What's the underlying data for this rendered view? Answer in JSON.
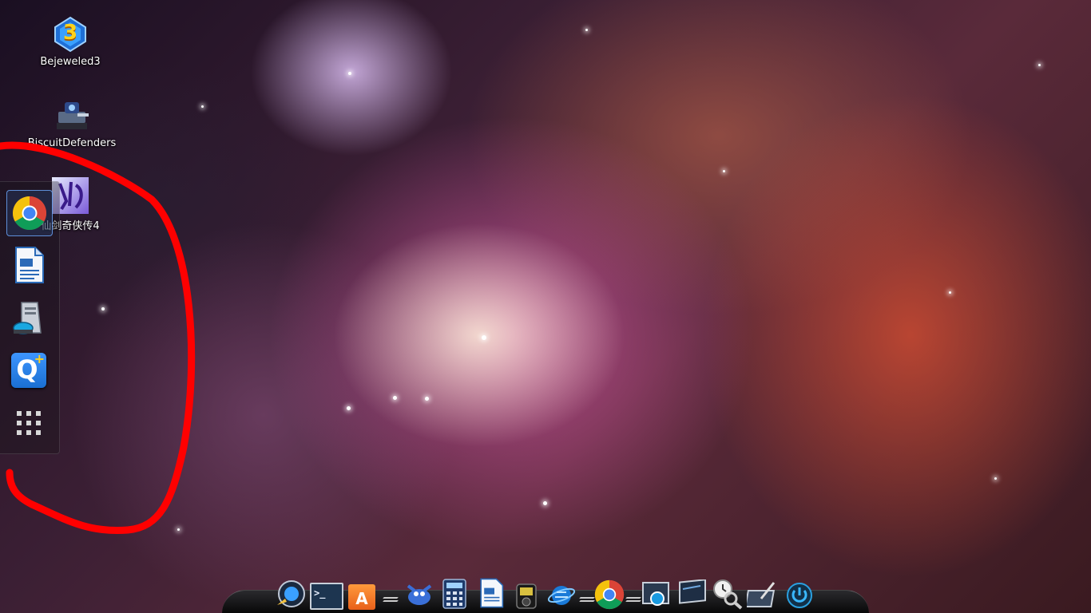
{
  "desktop": {
    "icons": [
      {
        "label": "Bejeweled3",
        "icon": "bejeweled3-icon"
      },
      {
        "label": "BiscuitDefenders",
        "icon": "biscuit-defenders-icon"
      },
      {
        "label": "仙剑奇侠传4",
        "icon": "xianjian4-icon"
      }
    ],
    "bejeweled_badge": "3"
  },
  "launcher": {
    "items": [
      {
        "name": "Chrome",
        "icon": "chrome-icon",
        "active": true
      },
      {
        "name": "LibreOffice Writer",
        "icon": "writer-icon"
      },
      {
        "name": "Computer",
        "icon": "computer-icon"
      },
      {
        "name": "QQ",
        "icon": "qq-icon",
        "glyph": "Q"
      },
      {
        "name": "Apps",
        "icon": "app-grid-icon"
      }
    ]
  },
  "dock": {
    "items": [
      {
        "name": "Launcher",
        "icon": "launcher-icon"
      },
      {
        "name": "Terminal",
        "icon": "terminal-icon",
        "glyph": ">_"
      },
      {
        "name": "Software Center",
        "icon": "store-bag-icon",
        "glyph": "A"
      },
      {
        "name": "GIMP",
        "icon": "gimp-icon"
      },
      {
        "name": "Calculator",
        "icon": "calculator-icon"
      },
      {
        "name": "Writer",
        "icon": "writer-icon"
      },
      {
        "name": "Media Player",
        "icon": "media-player-icon"
      },
      {
        "name": "Browser",
        "icon": "browser-globe-icon"
      },
      {
        "name": "Chrome",
        "icon": "chrome-icon"
      },
      {
        "name": "Screenshot",
        "icon": "camera-icon"
      },
      {
        "name": "Display",
        "icon": "display-icon"
      },
      {
        "name": "Clock Search",
        "icon": "clock-search-icon"
      },
      {
        "name": "Drawing",
        "icon": "drawing-tablet-icon"
      },
      {
        "name": "Power",
        "icon": "power-icon"
      }
    ]
  },
  "colors": {
    "annotation": "#ff0000",
    "chrome_red": "#db4437",
    "chrome_yellow": "#f4c20d",
    "chrome_green": "#0f9d58",
    "chrome_blue": "#4285f4",
    "qq_blue": "#1a6fd1"
  }
}
